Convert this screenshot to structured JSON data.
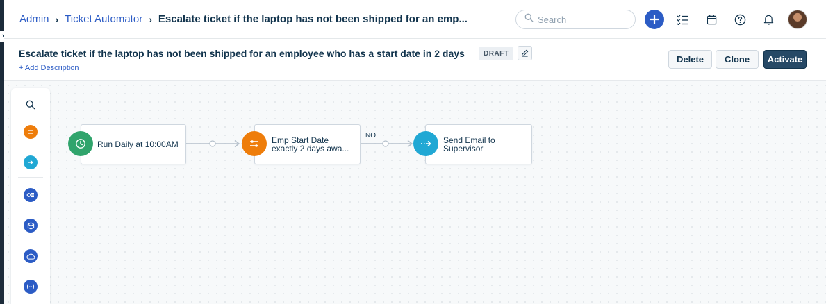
{
  "breadcrumb": {
    "admin": "Admin",
    "automator": "Ticket Automator",
    "current": "Escalate ticket if the laptop has not been shipped for an emp..."
  },
  "search": {
    "placeholder": "Search"
  },
  "header_icons": [
    "search-icon",
    "plus-icon",
    "checklist-icon",
    "calendar-icon",
    "help-icon",
    "bell-icon",
    "avatar"
  ],
  "title": {
    "text": "Escalate ticket if the laptop has not been shipped for an employee who has a start date in 2 days",
    "status": "DRAFT",
    "add_description": "+ Add Description"
  },
  "actions": {
    "delete": "Delete",
    "clone": "Clone",
    "activate": "Activate"
  },
  "palette": [
    "search-icon",
    "condition-icon",
    "action-icon",
    "query-icon",
    "asset-icon",
    "cloud-icon",
    "variable-icon"
  ],
  "workflow": {
    "nodes": [
      {
        "label": "Run Daily at 10:00AM",
        "icon": "clock-icon",
        "color": "#30a46c"
      },
      {
        "label": "Emp Start Date\nexactly 2 days awa...",
        "icon": "condition-icon",
        "color": "#ee7d0b"
      },
      {
        "label": "Send Email to\nSupervisor",
        "icon": "action-icon",
        "color": "#21a8d4"
      }
    ],
    "edge_label": "NO"
  },
  "colors": {
    "primary": "#2c5cc5",
    "activate": "#264966",
    "trigger": "#30a46c",
    "condition": "#ee7d0b",
    "action": "#21a8d4",
    "integration": "#2c5cc5"
  }
}
